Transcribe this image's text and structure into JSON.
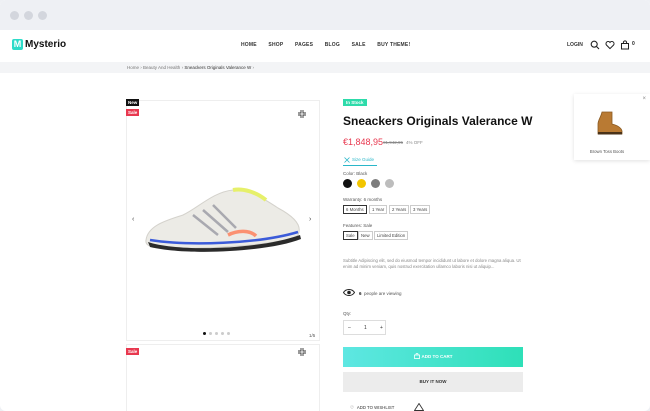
{
  "header": {
    "logo_letter": "M",
    "logo_text": "Mysterio",
    "nav": [
      "HOME",
      "SHOP",
      "PAGES",
      "BLOG",
      "SALE",
      "BUY THEME!"
    ],
    "login": "LOGIN",
    "cart_count": "0"
  },
  "breadcrumb": {
    "home": "Home",
    "category": "Beauty And Health",
    "current": "Sneackers Originals Valerance W"
  },
  "gallery": {
    "badge_new": "New",
    "badge_sale": "Sale",
    "counter": "1/5",
    "dots_total": 5,
    "active_dot": 0
  },
  "product": {
    "stock": "In Stock",
    "title": "Sneackers Originals Valerance W",
    "price": "€1,848,95",
    "old_price": "€1,942,95",
    "discount": "4% OFF",
    "size_guide": "Size Guide",
    "color_label": "Color: Black",
    "colors": [
      "#111111",
      "#f2c500",
      "#7d7d7d",
      "#bdbdbd"
    ],
    "warranty_label": "Warranty: 6 months",
    "warranty_options": [
      "6 Months",
      "1 Year",
      "2 Years",
      "3 Years"
    ],
    "features_label": "Features: Sale",
    "features_options": [
      "Sale",
      "New",
      "Limited Edition"
    ],
    "description": "Subtitle Adipiscing elit, sed do eiusmod tempor incididunt ut labore et dolore magna aliqua. Ut enim ad minim veniam, quis nostrud exercitation ullamco laboris nisi ut aliquip...",
    "viewing_count": "6",
    "viewing_text": "people are viewing",
    "qty_label": "Qty:",
    "qty_value": "1",
    "qty_minus": "–",
    "qty_plus": "+",
    "add_to_cart": "ADD TO CART",
    "buy_now": "BUY IT NOW",
    "wishlist": "ADD TO WISHLIST"
  },
  "popup": {
    "product_name": "Brown Toss Boots"
  },
  "colors": {
    "accent": "#2ddbc9",
    "sale": "#e8384f"
  }
}
